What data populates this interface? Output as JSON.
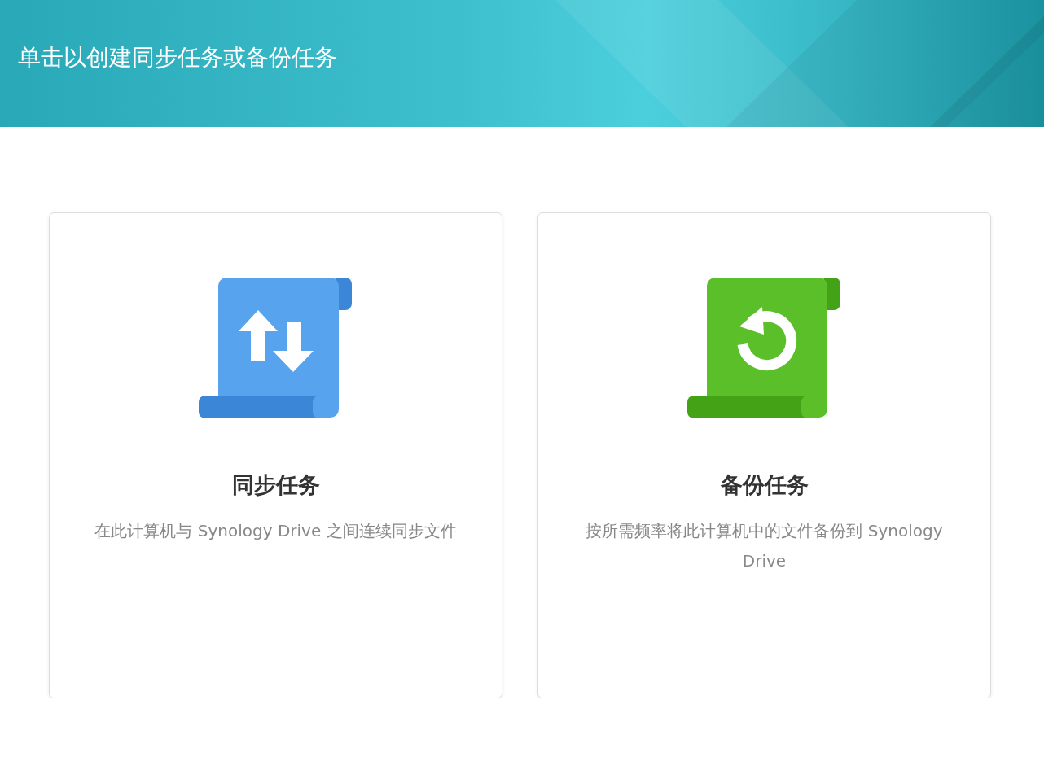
{
  "header": {
    "title": "单击以创建同步任务或备份任务"
  },
  "cards": [
    {
      "kind": "sync",
      "title": "同步任务",
      "description": "在此计算机与 Synology Drive 之间连续同步文件"
    },
    {
      "kind": "backup",
      "title": "备份任务",
      "description": "按所需频率将此计算机中的文件备份到 Synology Drive"
    }
  ]
}
